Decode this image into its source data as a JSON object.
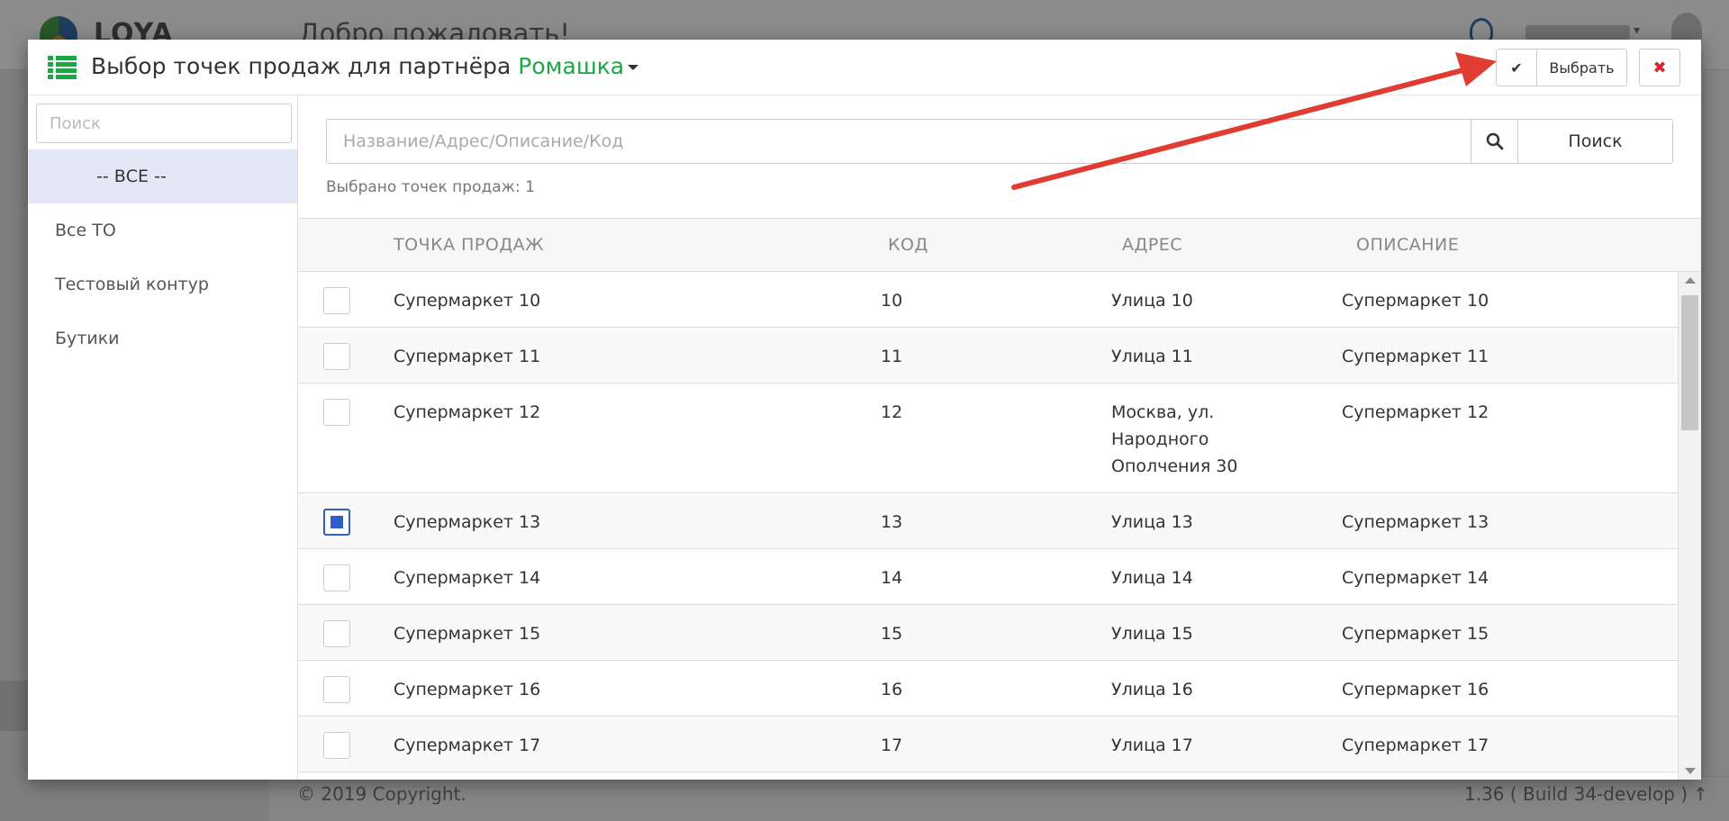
{
  "background": {
    "logo_text": "LOYA",
    "welcome": "Добро пожаловать!",
    "copyright": "© 2019 Copyright.",
    "build": "1.36 ( Build 34-develop )",
    "up_arrow": "↑"
  },
  "modal": {
    "title": "Выбор точек продаж для партнёра",
    "partner_name": "Ромашка",
    "check_glyph": "✔",
    "select_label": "Выбрать",
    "close_glyph": "✖",
    "colors": {
      "accent": "#1ea545",
      "danger": "#d9232d",
      "primary": "#2f5ec8",
      "arrow": "#e03c31"
    }
  },
  "sidebar": {
    "search_placeholder": "Поиск",
    "items": [
      {
        "label": "-- ВСЕ --",
        "active": true
      },
      {
        "label": "Все ТО",
        "active": false
      },
      {
        "label": "Тестовый контур",
        "active": false
      },
      {
        "label": "Бутики",
        "active": false
      }
    ]
  },
  "main": {
    "search_placeholder": "Название/Адрес/Описание/Код",
    "search_button": "Поиск",
    "selected_count": "Выбрано точек продаж: 1",
    "columns": [
      "ТОЧКА ПРОДАЖ",
      "КОД",
      "АДРЕС",
      "ОПИСАНИЕ"
    ],
    "rows": [
      {
        "name": "Супермаркет 10",
        "code": "10",
        "address": "Улица 10",
        "description": "Супермаркет 10",
        "checked": false
      },
      {
        "name": "Супермаркет 11",
        "code": "11",
        "address": "Улица 11",
        "description": "Супермаркет 11",
        "checked": false
      },
      {
        "name": "Супермаркет 12",
        "code": "12",
        "address": "Москва, ул. Народного Ополчения 30",
        "description": "Супермаркет 12",
        "checked": false
      },
      {
        "name": "Супермаркет 13",
        "code": "13",
        "address": "Улица 13",
        "description": "Супермаркет 13",
        "checked": true
      },
      {
        "name": "Супермаркет 14",
        "code": "14",
        "address": "Улица 14",
        "description": "Супермаркет 14",
        "checked": false
      },
      {
        "name": "Супермаркет 15",
        "code": "15",
        "address": "Улица 15",
        "description": "Супермаркет 15",
        "checked": false
      },
      {
        "name": "Супермаркет 16",
        "code": "16",
        "address": "Улица 16",
        "description": "Супермаркет 16",
        "checked": false
      },
      {
        "name": "Супермаркет 17",
        "code": "17",
        "address": "Улица 17",
        "description": "Супермаркет 17",
        "checked": false
      }
    ]
  }
}
